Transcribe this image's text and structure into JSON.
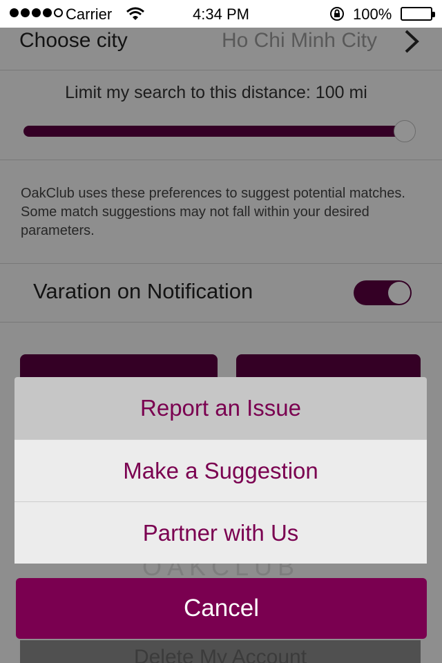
{
  "status_bar": {
    "carrier": "Carrier",
    "time": "4:34 PM",
    "battery": "100%",
    "signal_icon": "signal-dots-icon",
    "wifi_icon": "wifi-icon",
    "lock_icon": "rotation-lock-icon",
    "battery_icon": "battery-icon"
  },
  "settings": {
    "city": {
      "label": "Choose city",
      "value": "Ho Chi Minh City",
      "icon": "chevron-right-icon"
    },
    "distance": {
      "label": "Limit my search to this distance: 100 mi",
      "slider_level": 1.0
    },
    "disclaimer": "OakClub uses these preferences to suggest potential matches. Some match suggestions may not fall within your desired parameters.",
    "vibration": {
      "label": "Varation on Notification",
      "enabled": true
    },
    "logo": "OAKCLUB",
    "delete_account": "Delete My Account"
  },
  "action_sheet": {
    "items": [
      {
        "label": "Report an Issue"
      },
      {
        "label": "Make a Suggestion"
      },
      {
        "label": "Partner with Us"
      }
    ],
    "cancel": "Cancel"
  },
  "colors": {
    "accent": "#7a0050",
    "accent_dark": "#5a0040"
  }
}
